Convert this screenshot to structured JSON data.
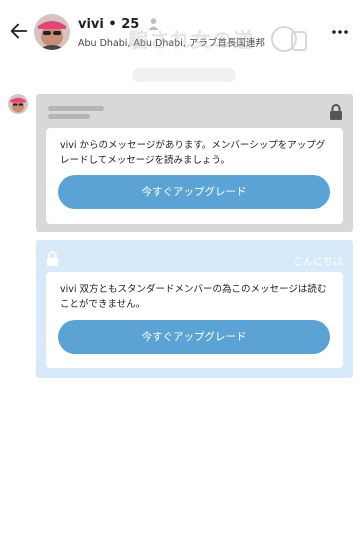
{
  "header": {
    "name_age": "vivi • 25",
    "location": "Abu Dhabi, Abu Dhabi, アラブ首長国連邦",
    "watermark_text": "騙され女の逆"
  },
  "icons": {
    "back": "arrow-left-icon",
    "person": "person-icon",
    "more": "more-dots-icon",
    "lock": "lock-icon"
  },
  "messages": {
    "locked": {
      "text": "vivi からのメッセージがあります。メンバーシップをアップグレードしてメッセージを読みましょう。",
      "button_label": "今すぐアップグレード"
    },
    "own": {
      "greeting": "こんにちは",
      "text": "vivi 双方ともスタンダードメンバーの為このメッセージは読むことができません。",
      "button_label": "今すぐアップグレード"
    }
  },
  "colors": {
    "accent": "#5ba3d4",
    "locked_bg": "#d8d8d8",
    "own_bg": "#d6eafa"
  }
}
